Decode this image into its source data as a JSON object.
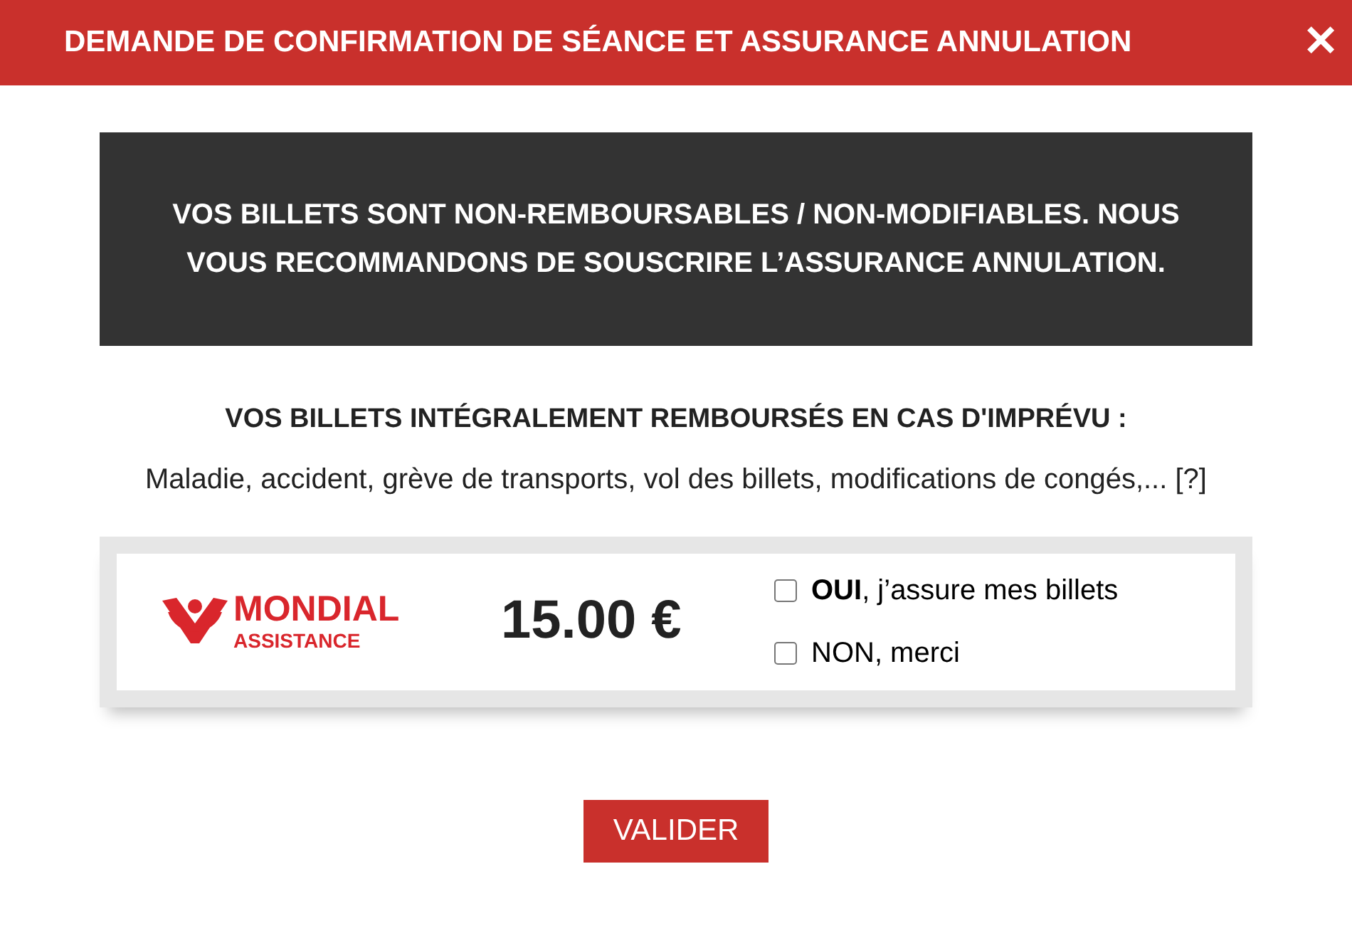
{
  "dialog": {
    "title": "DEMANDE DE CONFIRMATION DE SÉANCE ET ASSURANCE ANNULATION",
    "close": "✕"
  },
  "notice": "VOS BILLETS SONT NON-REMBOURSABLES / NON-MODIFIABLES. NOUS VOUS RECOMMANDONS DE SOUSCRIRE L’ASSURANCE ANNULATION.",
  "heading": "VOS BILLETS INTÉGRALEMENT REMBOURSÉS EN CAS D'IMPRÉVU :",
  "description": "Maladie, accident, grève de transports, vol des billets, modifications de congés,... [?]",
  "offer": {
    "brand": "MONDIAL",
    "brand_sub": "ASSISTANCE",
    "price": "15.00 €",
    "options": [
      {
        "label": "**OUI**, j’assure mes billets",
        "checked": false
      },
      {
        "label": "NON, merci",
        "checked": false
      }
    ]
  },
  "submit": "VALIDER"
}
